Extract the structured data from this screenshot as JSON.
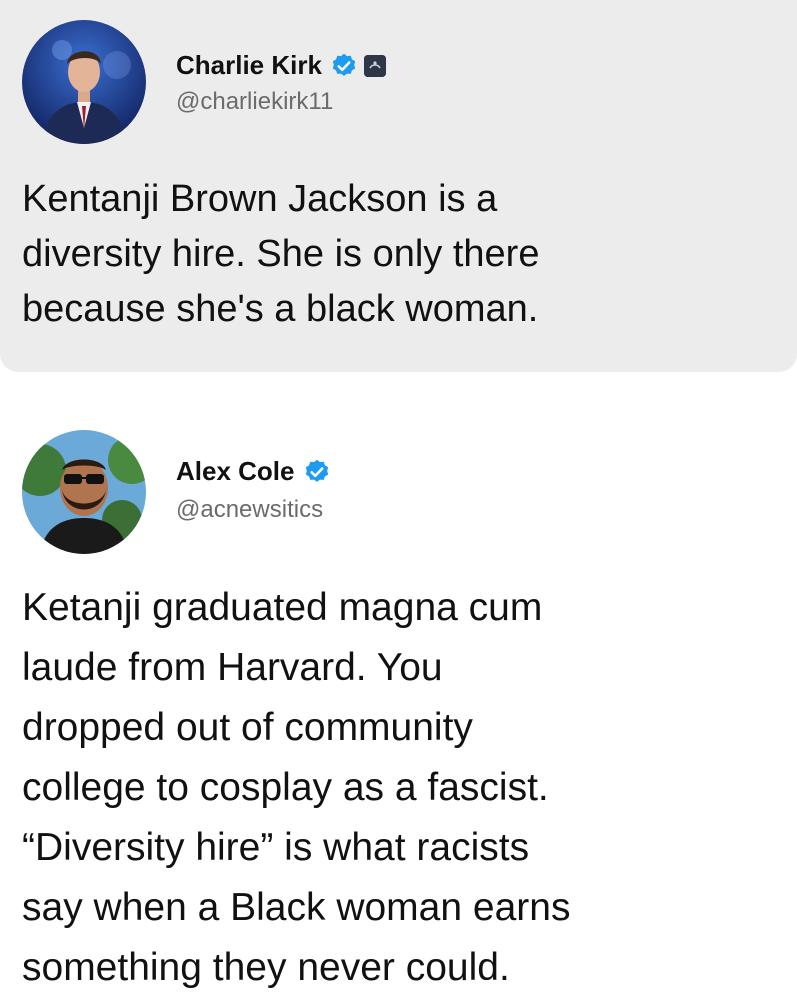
{
  "tweets": [
    {
      "display_name": "Charlie Kirk",
      "handle": "@charliekirk11",
      "verified": true,
      "affiliation_badge": true,
      "text": "Kentanji Brown Jackson is a\ndiversity hire. She is only there\nbecause she's a black woman."
    },
    {
      "display_name": "Alex Cole",
      "handle": "@acnewsitics",
      "verified": true,
      "affiliation_badge": false,
      "text": "Ketanji graduated magna cum\nlaude from Harvard. You\ndropped out of community\ncollege to cosplay as a fascist.\n“Diversity hire” is what racists\nsay when a Black woman earns\nsomething they never could."
    }
  ],
  "colors": {
    "verified_blue": "#1d9bf0",
    "first_tweet_bg": "#ececec",
    "handle_gray": "#6b6b6b"
  }
}
